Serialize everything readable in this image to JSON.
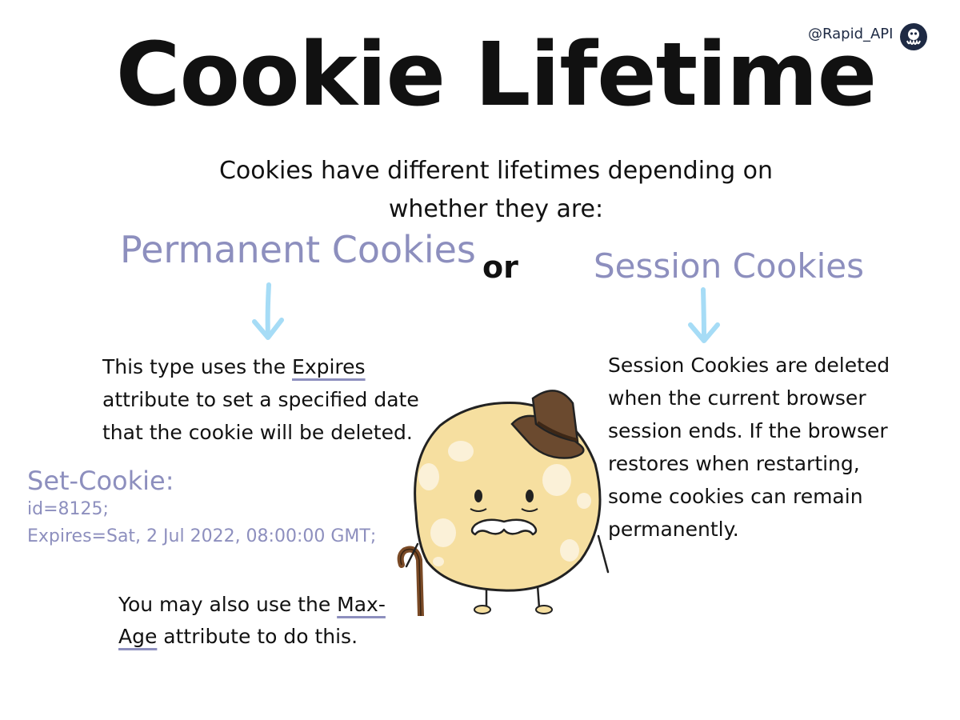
{
  "title": "Cookie Lifetime",
  "handle": "@Rapid_API",
  "intro": "Cookies have different lifetimes depending on whether they are:",
  "permanent": {
    "heading": "Permanent Cookies",
    "desc_before": "This type uses the ",
    "desc_keyword": "Expires",
    "desc_after": " attribute to set a specified date that the cookie will be deleted."
  },
  "connector": "or",
  "session": {
    "heading": "Session Cookies",
    "desc": "Session Cookies are deleted when the current browser session ends. If the browser restores when restarting, some cookies can remain permanently."
  },
  "code": {
    "title": "Set-Cookie:",
    "lines": [
      "id=8125;",
      "Expires=Sat, 2 Jul 2022, 08:00:00 GMT;"
    ]
  },
  "max_age": {
    "before": "You may also use the ",
    "keyword": "Max-Age",
    "after": " attribute to do this."
  },
  "colors": {
    "accent_purple": "#8d8fbe",
    "arrow_blue": "#a6dcf6",
    "cookie_fill": "#f6dfa0",
    "hat_brown": "#6b4a2f",
    "logo_navy": "#1e2a44"
  },
  "icons": [
    "rapidapi-logo-icon",
    "down-arrow-icon",
    "cookie-mascot-icon"
  ]
}
